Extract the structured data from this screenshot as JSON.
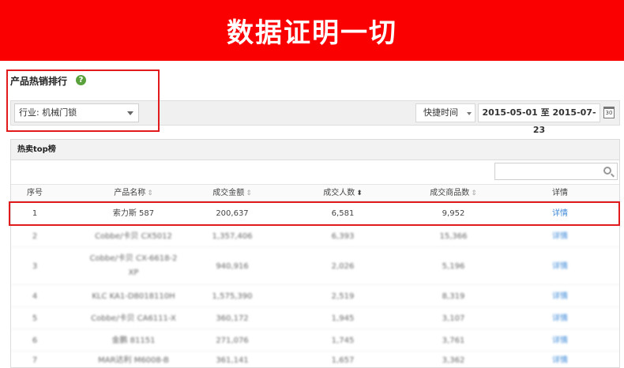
{
  "banner": {
    "title": "数据证明一切",
    "color": "#fb0000"
  },
  "section": {
    "title": "产品热销排行",
    "help_icon": "?"
  },
  "filter": {
    "industry_label": "行业: 机械门锁",
    "quick_time_label": "快捷时间",
    "date_range": "2015-05-01 至 2015-07-23",
    "calendar_icon_text": "30"
  },
  "panel": {
    "title": "热卖top榜",
    "search_placeholder": ""
  },
  "table": {
    "headers": [
      "序号",
      "产品名称",
      "成交金额",
      "成交人数",
      "成交商品数",
      "详情"
    ],
    "rows": [
      [
        "1",
        "索力斯 587",
        "200,637",
        "6,581",
        "9,952",
        "详情"
      ],
      [
        "2",
        "Cobbe/卡贝 CX5012",
        "1,357,406",
        "6,393",
        "15,366",
        "详情"
      ],
      [
        "3",
        "Cobbe/卡贝 CX-6618-2",
        "940,916",
        "2,026",
        "5,196",
        "详情"
      ],
      [
        "4",
        "KLC KA1-D8018110H",
        "1,575,390",
        "2,519",
        "8,319",
        "详情"
      ],
      [
        "5",
        "Cobbe/卡贝 CA6111-X",
        "360,172",
        "1,945",
        "3,107",
        "详情"
      ],
      [
        "6",
        "金鹏 81151",
        "271,076",
        "1,745",
        "3,761",
        "详情"
      ],
      [
        "7",
        "MAR达利 M6008-B",
        "361,141",
        "1,657",
        "3,362",
        "详情"
      ]
    ],
    "row3_suffix": "XP"
  },
  "colors": {
    "highlight": "#e11b1b",
    "link": "#3e8ad8",
    "help": "#5aa13c"
  }
}
